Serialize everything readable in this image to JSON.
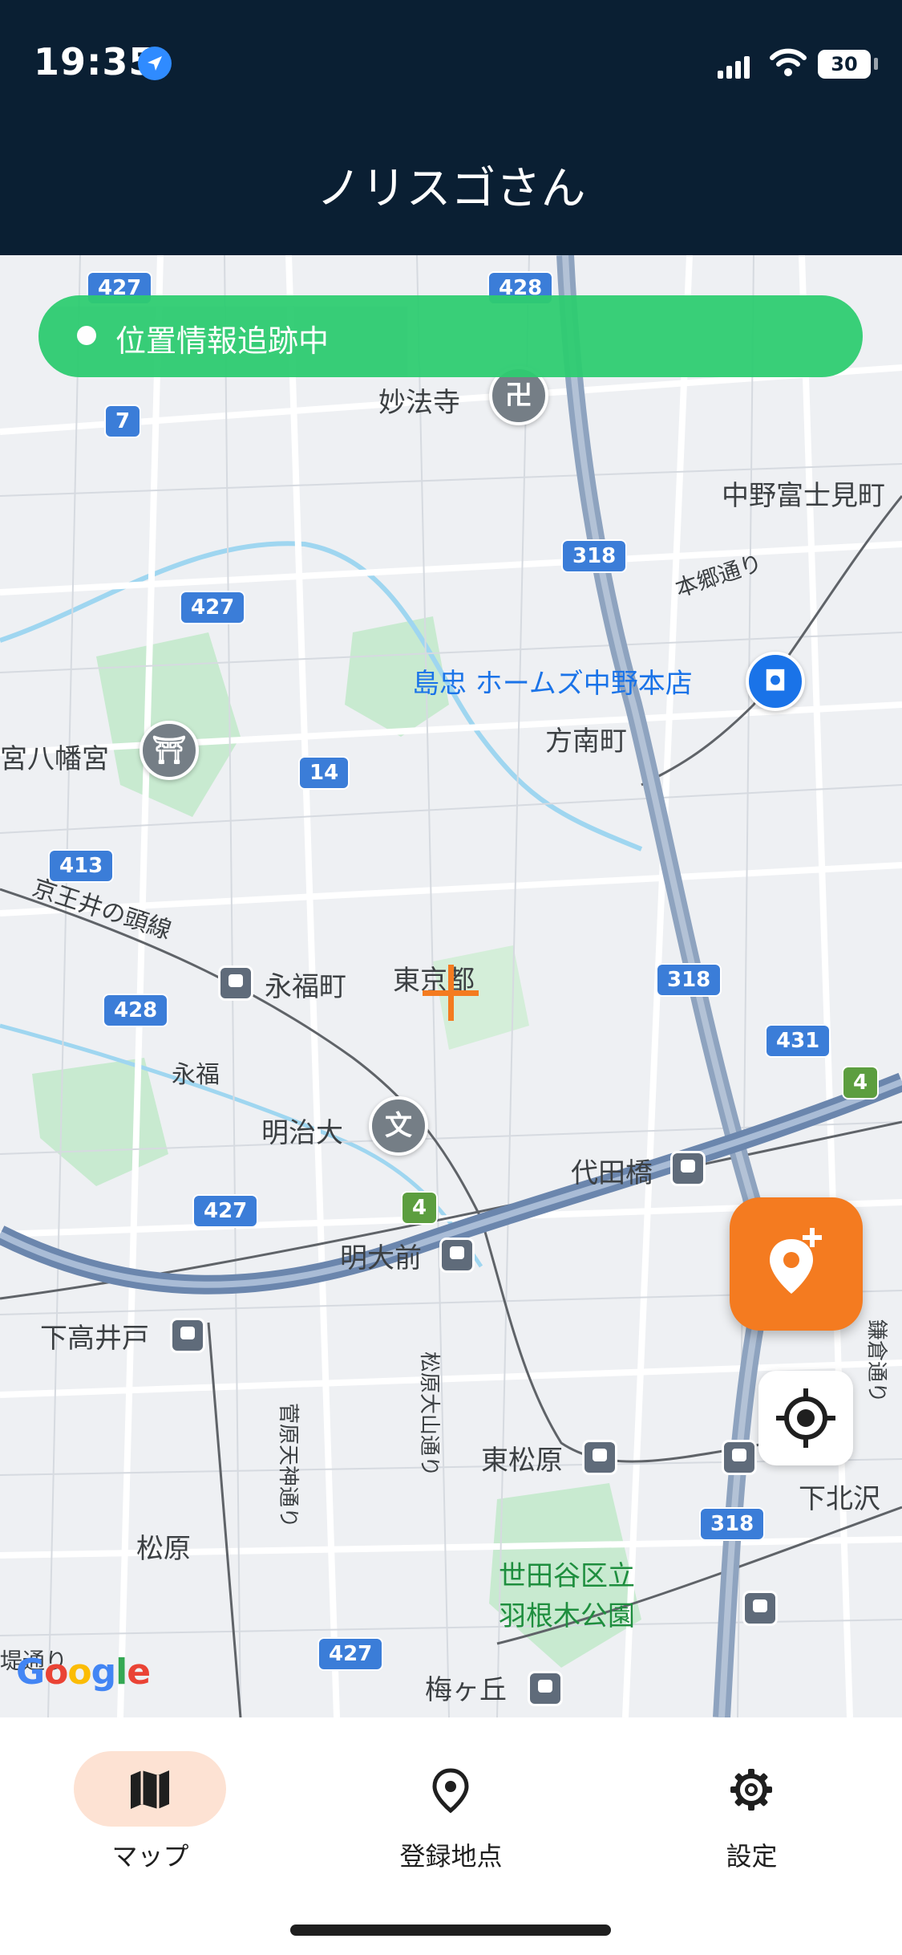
{
  "status_bar": {
    "time": "19:35",
    "battery": "30"
  },
  "app": {
    "title": "ノリスゴさん"
  },
  "tracking": {
    "text": "位置情報追跡中"
  },
  "map": {
    "labels": {
      "myohoji": "妙法寺",
      "nakano_fujimi": "中野富士見町",
      "hongo_dori": "本郷通り",
      "shimachu": "島忠 ホームズ中野本店",
      "honancho": "方南町",
      "omiya_hachimangu": "宮八幡宮",
      "keio_inokashira": "京王井の頭線",
      "eifukucho": "永福町",
      "eifuku": "永福",
      "higashi_kyoto": "東京都",
      "meijidai": "明治大",
      "daitabashi": "代田橋",
      "meidaimae": "明大前",
      "shimotakaido": "下高井戸",
      "sugawara_tenjin": "菅原天神通り",
      "matsubara_oyama": "松原大山通り",
      "higashi_matsubara": "東松原",
      "shimokitazawa": "下北沢",
      "kamakura_dori": "鎌倉通り",
      "matsubara": "松原",
      "hanegi_park_1": "世田谷区立",
      "hanegi_park_2": "羽根木公園",
      "umegaoka": "梅ヶ丘",
      "tsutsumi_dori": "堤通り"
    },
    "shields": {
      "r427a": "427",
      "r428a": "428",
      "r7": "7",
      "r318a": "318",
      "r427b": "427",
      "r14": "14",
      "r413": "413",
      "r318b": "318",
      "r428b": "428",
      "r431": "431",
      "r4a": "4",
      "r4b": "4",
      "r427c": "427",
      "r318c": "318",
      "r427d": "427"
    },
    "attribution": {
      "g1": "G",
      "o1": "o",
      "o2": "o",
      "g2": "g",
      "l": "l",
      "e": "e"
    },
    "colors": {
      "accent": "#f47b20",
      "tracking_green": "#2ecc71",
      "header_navy": "#0a1f33",
      "highway": "#8ea3bf"
    }
  },
  "nav": {
    "map": "マップ",
    "places": "登録地点",
    "settings": "設定"
  }
}
